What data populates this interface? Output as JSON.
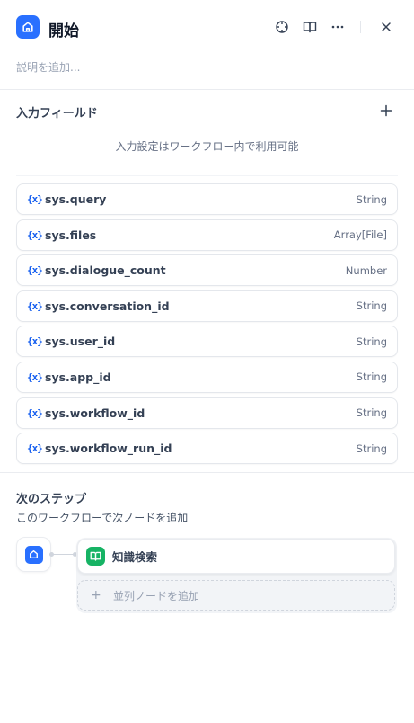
{
  "header": {
    "title": "開始",
    "icon": "home-icon",
    "accent": "#2970ff",
    "actions": [
      "crosshair-icon",
      "book-open-icon",
      "more-horizontal-icon",
      "close-icon"
    ]
  },
  "description_placeholder": "説明を追加...",
  "input_fields": {
    "title": "入力フィールド",
    "add_icon": "plus-icon",
    "hint": "入力設定はワークフロー内で利用可能",
    "variables": [
      {
        "icon": "{x}",
        "name": "sys.query",
        "type": "String"
      },
      {
        "icon": "{x}",
        "name": "sys.files",
        "type": "Array[File]"
      },
      {
        "icon": "{x}",
        "name": "sys.dialogue_count",
        "type": "Number"
      },
      {
        "icon": "{x}",
        "name": "sys.conversation_id",
        "type": "String"
      },
      {
        "icon": "{x}",
        "name": "sys.user_id",
        "type": "String"
      },
      {
        "icon": "{x}",
        "name": "sys.app_id",
        "type": "String"
      },
      {
        "icon": "{x}",
        "name": "sys.workflow_id",
        "type": "String"
      },
      {
        "icon": "{x}",
        "name": "sys.workflow_run_id",
        "type": "String"
      }
    ]
  },
  "next_step": {
    "title": "次のステップ",
    "description": "このワークフローで次ノードを追加",
    "node_label": "知識検索",
    "node_color": "#16b364",
    "add_parallel_label": "並列ノードを追加"
  }
}
